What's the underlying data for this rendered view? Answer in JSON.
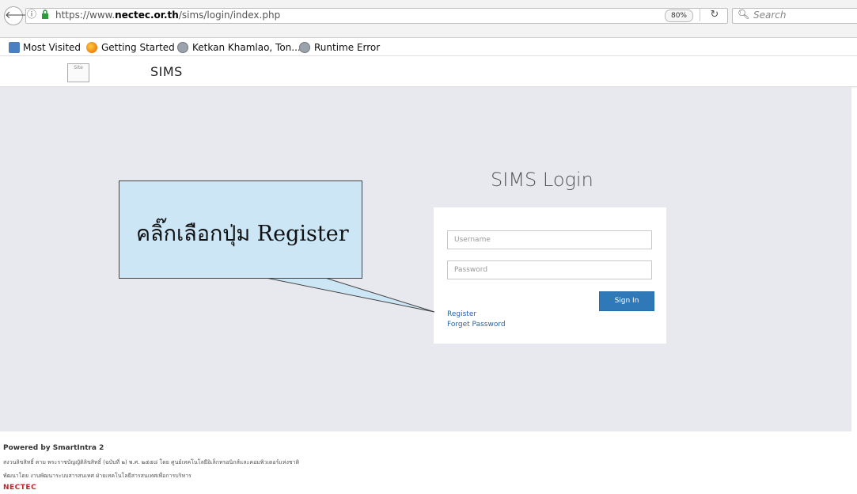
{
  "browser": {
    "url_prefix": "https://www.",
    "url_domain": "nectec.or.th",
    "url_path": "/sims/login/index.php",
    "zoom": "80%",
    "search_placeholder": "Search"
  },
  "bookmarks": [
    {
      "label": "Most Visited",
      "icon": "most-visited-icon"
    },
    {
      "label": "Getting Started",
      "icon": "firefox-icon"
    },
    {
      "label": "Ketkan Khamlao, Ton...",
      "icon": "globe-icon"
    },
    {
      "label": "Runtime Error",
      "icon": "globe-icon"
    }
  ],
  "header": {
    "logo_text": "Site",
    "brand": "SIMS"
  },
  "login": {
    "title": "SIMS Login",
    "username_placeholder": "Username",
    "password_placeholder": "Password",
    "signin_label": "Sign In",
    "register_label": "Register",
    "forget_label": "Forget Password"
  },
  "callout": {
    "text": "คลิ๊กเลือกปุ่ม Register"
  },
  "footer": {
    "powered": "Powered by SmartIntra 2",
    "line1": "สงวนลิขสิทธิ์ ตาม พระราชบัญญัติลิขสิทธิ์ (ฉบับที่ ๒) พ.ศ. ๒๕๕๘ โดย ศูนย์เทคโนโลยีอิเล็กทรอนิกส์และคอมพิวเตอร์แห่งชาติ",
    "line2": "พัฒนาโดย งานพัฒนาระบบสารสนเทศ ฝ่ายเทคโนโลยีสารสนเทศเพื่อการบริหาร",
    "logo": "NECTEC"
  }
}
